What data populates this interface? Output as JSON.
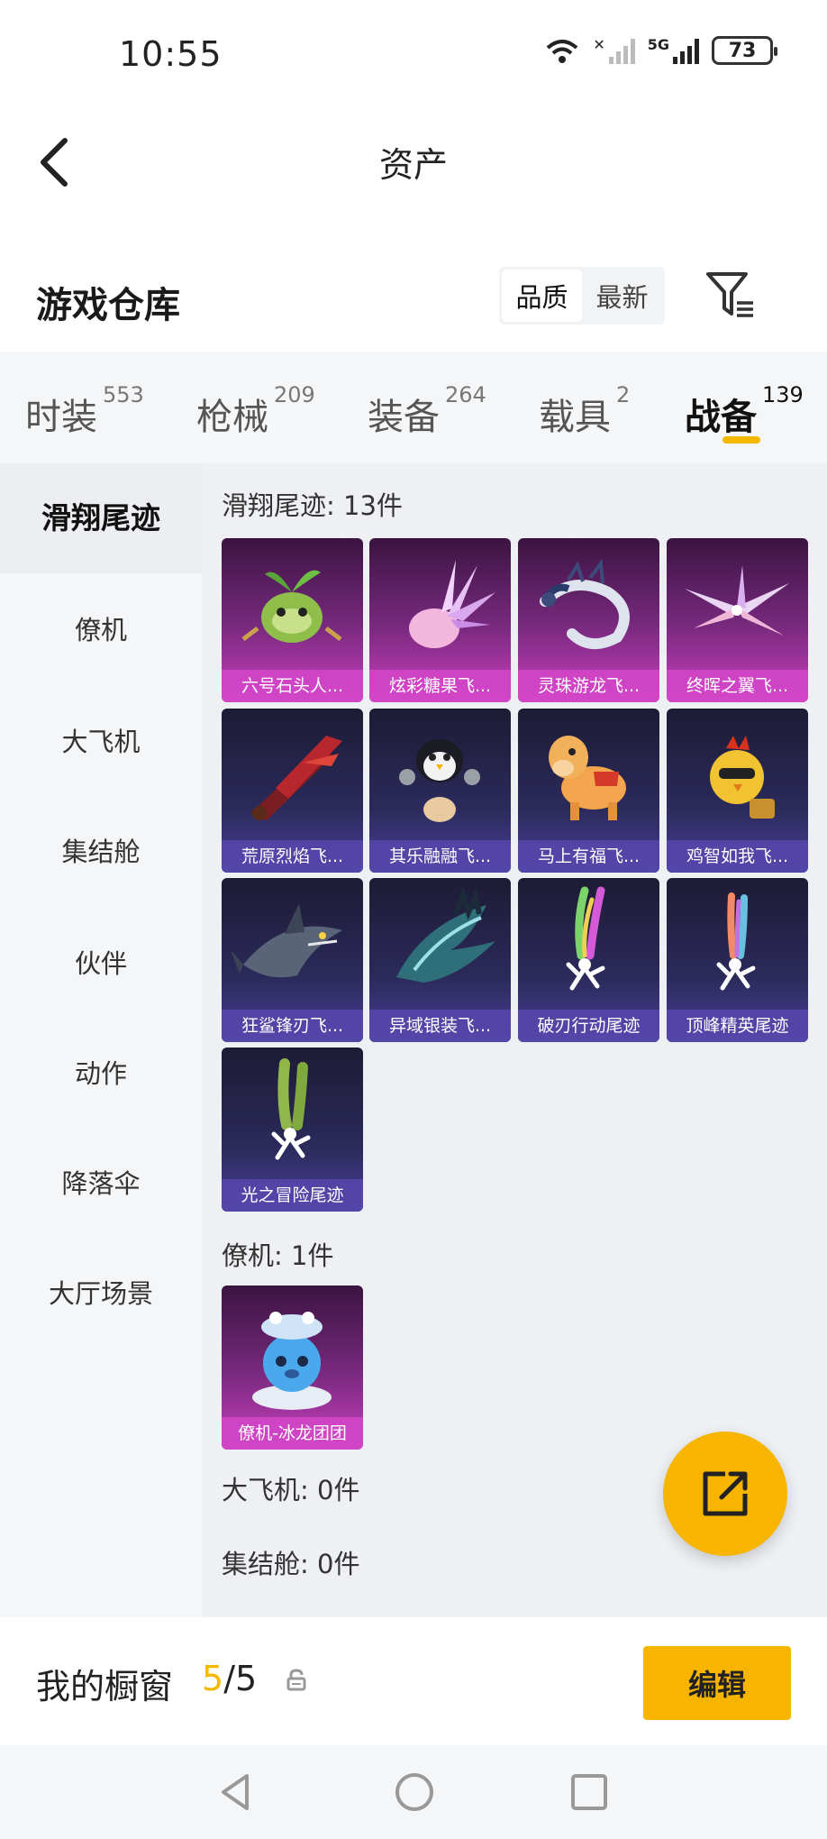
{
  "status_bar": {
    "time": "10:55",
    "battery": "73",
    "network": "5G"
  },
  "header": {
    "title": "资产"
  },
  "warehouse": {
    "title": "游戏仓库",
    "sort_options": [
      "品质",
      "最新"
    ],
    "active_sort": "品质"
  },
  "categories": [
    {
      "label": "时装",
      "count": "553"
    },
    {
      "label": "枪械",
      "count": "209"
    },
    {
      "label": "装备",
      "count": "264"
    },
    {
      "label": "载具",
      "count": "2"
    },
    {
      "label": "战备",
      "count": "139"
    }
  ],
  "active_category": "战备",
  "sidebar": {
    "items": [
      "滑翔尾迹",
      "僚机",
      "大飞机",
      "集结舱",
      "伙伴",
      "动作",
      "降落伞",
      "大厅场景"
    ],
    "active": "滑翔尾迹"
  },
  "sections": [
    {
      "title": "滑翔尾迹: 13件",
      "items": [
        {
          "name": "六号石头人...",
          "rarity": "purple",
          "icon": "green-sprout-creature-icon"
        },
        {
          "name": "炫彩糖果飞...",
          "rarity": "purple",
          "icon": "candy-wings-icon"
        },
        {
          "name": "灵珠游龙飞...",
          "rarity": "purple",
          "icon": "dragon-icon"
        },
        {
          "name": "终晖之翼飞...",
          "rarity": "purple",
          "icon": "crystal-wings-icon"
        },
        {
          "name": "荒原烈焰飞...",
          "rarity": "navy",
          "icon": "flame-glider-icon"
        },
        {
          "name": "其乐融融飞...",
          "rarity": "navy",
          "icon": "penguin-icon"
        },
        {
          "name": "马上有福飞...",
          "rarity": "navy",
          "icon": "horse-icon"
        },
        {
          "name": "鸡智如我飞...",
          "rarity": "navy",
          "icon": "chicken-icon"
        },
        {
          "name": "狂鲨锋刃飞...",
          "rarity": "navy",
          "icon": "shark-icon"
        },
        {
          "name": "异域银装飞...",
          "rarity": "navy",
          "icon": "silver-wing-icon"
        },
        {
          "name": "破刃行动尾迹",
          "rarity": "navy",
          "icon": "rainbow-trail-icon"
        },
        {
          "name": "顶峰精英尾迹",
          "rarity": "navy",
          "icon": "colorful-trail-icon"
        },
        {
          "name": "光之冒险尾迹",
          "rarity": "navy",
          "icon": "green-trail-icon"
        }
      ]
    },
    {
      "title": "僚机: 1件",
      "items": [
        {
          "name": "僚机-冰龙团团",
          "rarity": "purple",
          "icon": "ice-dragon-icon"
        }
      ]
    },
    {
      "title": "大飞机: 0件",
      "items": []
    },
    {
      "title": "集结舱: 0件",
      "items": []
    }
  ],
  "bottom": {
    "window_label": "我的橱窗",
    "window_current": "5",
    "window_sep": "/",
    "window_total": "5",
    "edit_label": "编辑"
  },
  "colors": {
    "accent": "#f7b500",
    "purple_card": "#7a2a80",
    "navy_card": "#2b2a5a"
  }
}
